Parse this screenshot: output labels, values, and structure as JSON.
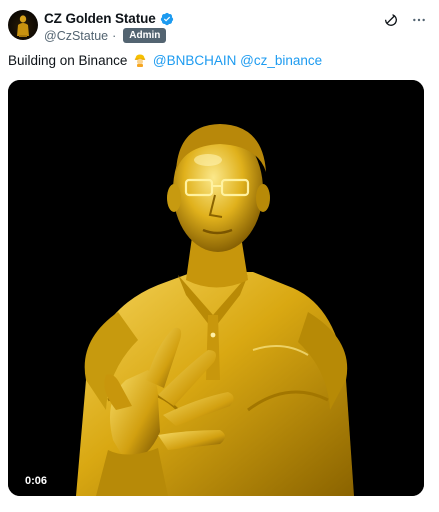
{
  "post": {
    "author": {
      "display_name": "CZ Golden Statue",
      "handle": "@CzStatue",
      "separator": "·",
      "badge": "Admin",
      "verified_icon": "verified-badge-icon",
      "avatar_icon": "golden-statue-avatar"
    },
    "top_icons": [
      "grok-icon",
      "more-options-icon"
    ],
    "text": {
      "prefix": "Building on Binance",
      "emoji": "construction-worker-emoji",
      "mention_1": "@BNBCHAIN",
      "mention_2": "@cz_binance"
    },
    "media": {
      "type": "video",
      "duration": "0:06",
      "subject": "golden-statue-video"
    }
  },
  "colors": {
    "text": "#0f1419",
    "secondary": "#536471",
    "link": "#1d9bf0",
    "verified": "#1d9bf0",
    "badge_bg": "#536471",
    "gold": "#d4a90f"
  }
}
